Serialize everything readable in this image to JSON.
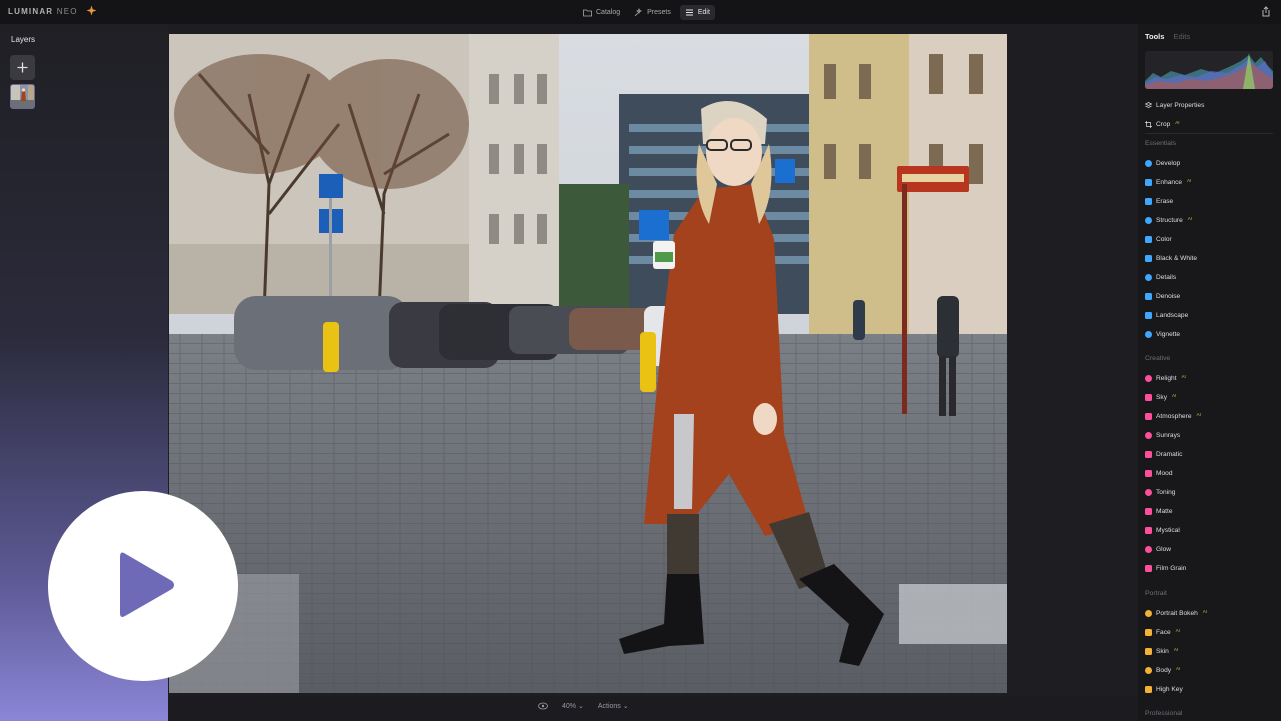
{
  "app": {
    "logo_main": "LUMINAR",
    "logo_sub": "NEO"
  },
  "topnav": {
    "catalog": "Catalog",
    "presets": "Presets",
    "edit": "Edit",
    "active": "Edit"
  },
  "left_panel": {
    "title": "Layers",
    "add_icon": "plus-icon"
  },
  "bottom": {
    "zoom": "40%",
    "actions": "Actions"
  },
  "right_panel": {
    "tab_tools": "Tools",
    "tab_edits": "Edits",
    "layer_properties": "Layer Properties",
    "crop": "Crop",
    "sections": {
      "essentials": "Essentials",
      "creative": "Creative",
      "portrait": "Portrait",
      "professional": "Professional"
    },
    "essentials": [
      {
        "label": "Develop",
        "icon": "develop-icon",
        "color": "#3fa7ff",
        "badge": ""
      },
      {
        "label": "Enhance",
        "icon": "enhance-icon",
        "color": "#3fa7ff",
        "badge": "AI"
      },
      {
        "label": "Erase",
        "icon": "erase-icon",
        "color": "#3fa7ff",
        "badge": ""
      },
      {
        "label": "Structure",
        "icon": "structure-icon",
        "color": "#3fa7ff",
        "badge": "AI"
      },
      {
        "label": "Color",
        "icon": "color-icon",
        "color": "#3fa7ff",
        "badge": ""
      },
      {
        "label": "Black & White",
        "icon": "black-white-icon",
        "color": "#3fa7ff",
        "badge": ""
      },
      {
        "label": "Details",
        "icon": "details-icon",
        "color": "#3fa7ff",
        "badge": ""
      },
      {
        "label": "Denoise",
        "icon": "denoise-icon",
        "color": "#3fa7ff",
        "badge": ""
      },
      {
        "label": "Landscape",
        "icon": "landscape-icon",
        "color": "#3fa7ff",
        "badge": ""
      },
      {
        "label": "Vignette",
        "icon": "vignette-icon",
        "color": "#3fa7ff",
        "badge": ""
      }
    ],
    "creative": [
      {
        "label": "Relight",
        "icon": "relight-icon",
        "color": "#ff4f9a",
        "badge": "AI"
      },
      {
        "label": "Sky",
        "icon": "sky-icon",
        "color": "#ff4f9a",
        "badge": "AI"
      },
      {
        "label": "Atmosphere",
        "icon": "atmosphere-icon",
        "color": "#ff4f9a",
        "badge": "AI"
      },
      {
        "label": "Sunrays",
        "icon": "sunrays-icon",
        "color": "#ff4f9a",
        "badge": ""
      },
      {
        "label": "Dramatic",
        "icon": "dramatic-icon",
        "color": "#ff4f9a",
        "badge": ""
      },
      {
        "label": "Mood",
        "icon": "mood-icon",
        "color": "#ff4f9a",
        "badge": ""
      },
      {
        "label": "Toning",
        "icon": "toning-icon",
        "color": "#ff4f9a",
        "badge": ""
      },
      {
        "label": "Matte",
        "icon": "matte-icon",
        "color": "#ff4f9a",
        "badge": ""
      },
      {
        "label": "Mystical",
        "icon": "mystical-icon",
        "color": "#ff4f9a",
        "badge": ""
      },
      {
        "label": "Glow",
        "icon": "glow-icon",
        "color": "#ff4f9a",
        "badge": ""
      },
      {
        "label": "Film Grain",
        "icon": "film-grain-icon",
        "color": "#ff4f9a",
        "badge": ""
      }
    ],
    "portrait": [
      {
        "label": "Portrait Bokeh",
        "icon": "portrait-bokeh-icon",
        "color": "#f2b233",
        "badge": "AI"
      },
      {
        "label": "Face",
        "icon": "face-icon",
        "color": "#f2b233",
        "badge": "AI"
      },
      {
        "label": "Skin",
        "icon": "skin-icon",
        "color": "#f2b233",
        "badge": "AI"
      },
      {
        "label": "Body",
        "icon": "body-icon",
        "color": "#f2b233",
        "badge": "AI"
      },
      {
        "label": "High Key",
        "icon": "high-key-icon",
        "color": "#f2b233",
        "badge": ""
      }
    ]
  },
  "overlay": {
    "play_icon": "play-icon",
    "play_color": "#6e6ab8"
  }
}
